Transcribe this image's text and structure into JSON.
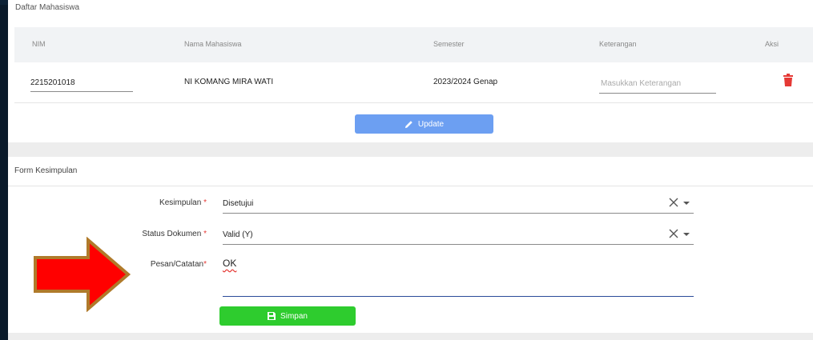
{
  "daftar": {
    "title": "Daftar Mahasiswa",
    "columns": [
      "NIM",
      "Nama Mahasiswa",
      "Semester",
      "Keterangan",
      "Aksi"
    ],
    "rows": [
      {
        "nim": "2215201018",
        "nama": "NI KOMANG MIRA WATI",
        "semester": "2023/2024 Genap",
        "keterangan_placeholder": "Masukkan Keterangan"
      }
    ],
    "update_label": "Update"
  },
  "form": {
    "title": "Form Kesimpulan",
    "kesimpulan_label": "Kesimpulan",
    "kesimpulan_value": "Disetujui",
    "status_label": "Status Dokumen",
    "status_value": "Valid (Y)",
    "pesan_label": "Pesan/Catatan",
    "pesan_value": "OK",
    "required_mark": "*",
    "simpan_label": "Simpan"
  },
  "colors": {
    "update_button": "#6c9ff2",
    "simpan_button": "#2ecc2e",
    "danger": "#e53935",
    "arrow_fill": "#ff0000",
    "arrow_border": "#b07a2a"
  },
  "icons": [
    "pencil-icon",
    "trash-icon",
    "clear-icon",
    "caret-down-icon",
    "save-icon",
    "arrow-right-icon"
  ]
}
